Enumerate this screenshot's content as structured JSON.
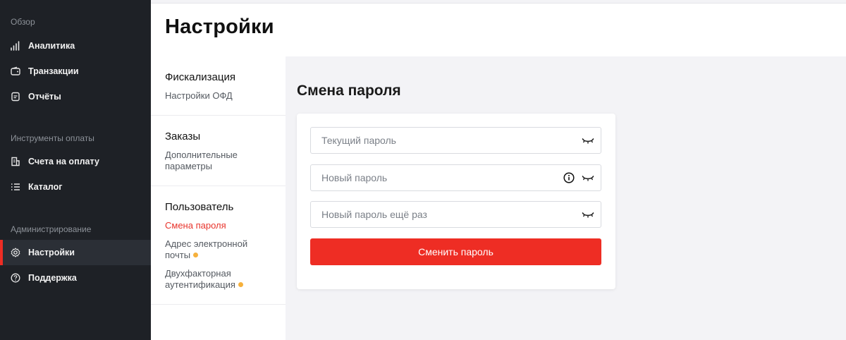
{
  "sidebar": {
    "sections": [
      "Обзор",
      "Инструменты оплаты",
      "Администрирование"
    ],
    "items": [
      {
        "label": "Аналитика",
        "icon": "chart-bars-icon"
      },
      {
        "label": "Транзакции",
        "icon": "wallet-icon"
      },
      {
        "label": "Отчёты",
        "icon": "report-icon"
      },
      {
        "label": "Счета на оплату",
        "icon": "invoice-icon"
      },
      {
        "label": "Каталог",
        "icon": "list-icon"
      },
      {
        "label": "Настройки",
        "icon": "gear-icon",
        "active": true
      },
      {
        "label": "Поддержка",
        "icon": "help-circle-icon"
      }
    ]
  },
  "header": {
    "title": "Настройки"
  },
  "settings_nav": {
    "groups": [
      {
        "title": "Фискализация",
        "links": [
          {
            "label": "Настройки ОФД"
          }
        ]
      },
      {
        "title": "Заказы",
        "links": [
          {
            "label": "Дополнительные параметры"
          }
        ]
      },
      {
        "title": "Пользователь",
        "links": [
          {
            "label": "Смена пароля",
            "active": true
          },
          {
            "label": "Адрес электронной почты",
            "badge": true
          },
          {
            "label": "Двухфакторная аутентификация",
            "badge": true
          }
        ]
      }
    ]
  },
  "main": {
    "section_title": "Смена пароля",
    "fields": {
      "current_password": {
        "placeholder": "Текущий пароль",
        "value": ""
      },
      "new_password": {
        "placeholder": "Новый пароль",
        "value": ""
      },
      "repeat_password": {
        "placeholder": "Новый пароль ещё раз",
        "value": ""
      }
    },
    "submit_label": "Сменить пароль"
  },
  "colors": {
    "accent": "#ee2d24",
    "sidebar_bg": "#1e2126",
    "badge": "#f6b13c",
    "active_link": "#e8342c"
  }
}
